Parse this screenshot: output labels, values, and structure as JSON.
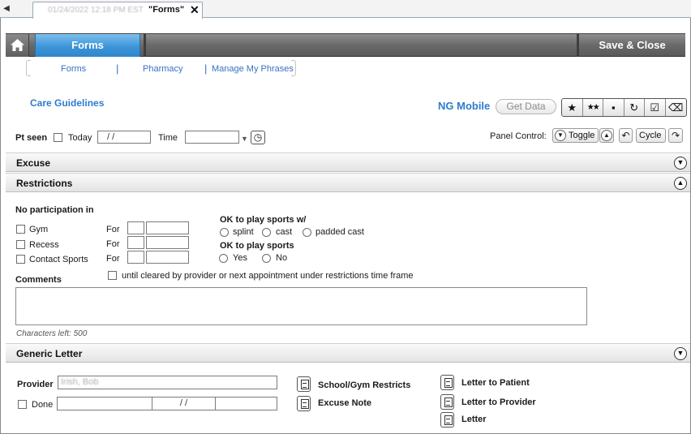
{
  "tab": {
    "scroll_glyph": "◀",
    "date_text": "01/24/2022 12:18 PM EST",
    "title": "\"Forms\"",
    "close_glyph": "✕"
  },
  "toolbar": {
    "home_icon": "home-icon",
    "forms_label": "Forms",
    "save_close_label": "Save & Close"
  },
  "subnav": {
    "items": [
      "Forms",
      "Pharmacy",
      "Manage My Phrases"
    ],
    "separator": "|"
  },
  "care_guidelines": "Care Guidelines",
  "ng_mobile": "NG Mobile",
  "get_data": "Get Data",
  "icon_toolbar": {
    "glyphs": [
      "★",
      "★★",
      "▪",
      "↻",
      "☑",
      "⌫"
    ],
    "icons": [
      "star-icon",
      "double-star-icon",
      "save-icon",
      "refresh-icon",
      "checklist-icon",
      "eraser-icon"
    ]
  },
  "pt_seen": {
    "label": "Pt seen",
    "today_label": "Today",
    "date_value": "/ /",
    "time_label": "Time",
    "time_value": "",
    "dropdown_glyph": "▼",
    "clock_glyph": "◷"
  },
  "panel_control": {
    "label": "Panel Control:",
    "toggle": "Toggle",
    "cycle": "Cycle",
    "down_glyph": "▼",
    "up_glyph": "▲",
    "undo_glyph": "↶",
    "redo_glyph": "↷"
  },
  "sections": {
    "excuse": "Excuse",
    "restrictions": "Restrictions",
    "generic_letter": "Generic Letter"
  },
  "restrictions": {
    "no_participation": "No participation in",
    "items": [
      "Gym",
      "Recess",
      "Contact Sports"
    ],
    "for_label": "For",
    "ok_sports_with": "OK to play sports w/",
    "cast_options": [
      "splint",
      "cast",
      "padded cast"
    ],
    "ok_sports": "OK to play sports",
    "yes": "Yes",
    "no": "No",
    "comments": "Comments",
    "until_cleared": "until cleared by provider or next appointment under restrictions time frame",
    "chars_left": "Characters left: 500"
  },
  "generic_letter": {
    "provider_label": "Provider",
    "provider_value": "Irish, Bob",
    "done_label": "Done",
    "done_date": "/ /",
    "letters_left": [
      "School/Gym Restricts",
      "Excuse Note"
    ],
    "letters_right": [
      "Letter to Patient",
      "Letter to Provider",
      "Letter"
    ]
  }
}
